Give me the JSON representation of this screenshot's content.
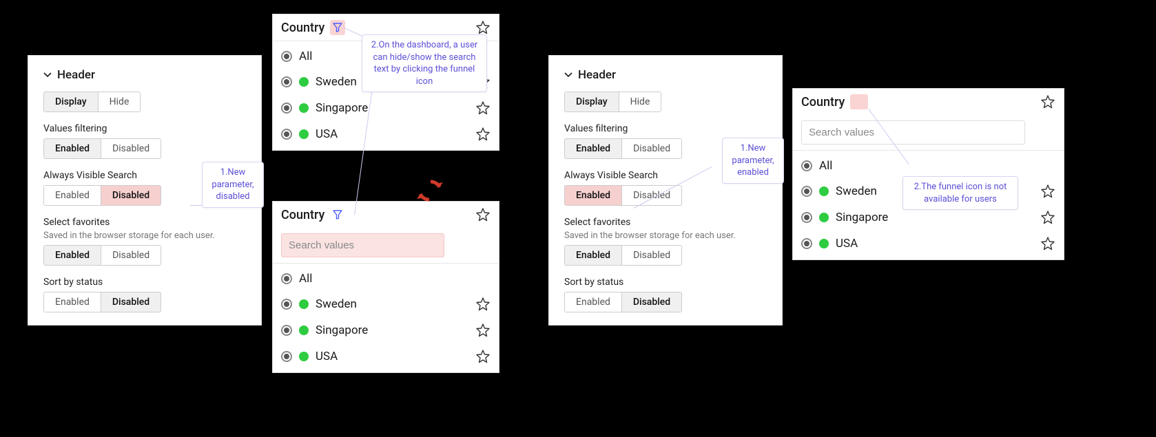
{
  "settings": {
    "header_title": "Header",
    "display_toggle": {
      "a": "Display",
      "b": "Hide"
    },
    "values_filtering": {
      "label": "Values filtering",
      "a": "Enabled",
      "b": "Disabled"
    },
    "always_visible_search": {
      "label": "Always Visible Search",
      "a": "Enabled",
      "b": "Disabled"
    },
    "select_favorites": {
      "label": "Select favorites",
      "sub": "Saved in the browser storage for each user.",
      "a": "Enabled",
      "b": "Disabled"
    },
    "sort_by_status": {
      "label": "Sort by status",
      "a": "Enabled",
      "b": "Disabled"
    }
  },
  "var": {
    "title": "Country",
    "search_placeholder": "Search values",
    "all": "All",
    "items": [
      {
        "label": "Sweden"
      },
      {
        "label": "Singapore"
      },
      {
        "label": "USA"
      }
    ]
  },
  "callouts": {
    "c1": "1.New parameter, disabled",
    "c2": "2.On the dashboard, a user can hide/show the search text by clicking the funnel icon",
    "c3": "1.New parameter, enabled",
    "c4": "2.The funnel icon is not available for users"
  },
  "colors": {
    "highlight": "#f6d0cf",
    "callout_text": "#5b4fd6",
    "green_dot": "#2ecc40",
    "sync_arrows": "#d03a2b"
  }
}
